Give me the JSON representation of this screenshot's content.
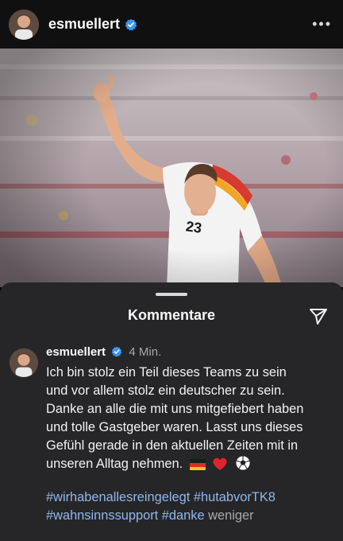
{
  "header": {
    "username": "esmuellert",
    "more_icon": "more-horizontal-icon"
  },
  "sheet": {
    "title": "Kommentare"
  },
  "comment": {
    "username": "esmuellert",
    "time": "4 Min.",
    "lines": [
      "Ich bin stolz ein Teil dieses Teams zu sein",
      "und vor allem stolz ein deutscher zu sein.",
      "Danke an alle die mit uns mitgefiebert haben",
      "und tolle Gastgeber waren. Lasst uns dieses",
      "Gefühl gerade in den aktuellen Zeiten mit in",
      "unseren Alltag nehmen."
    ],
    "emojis": [
      "flag-germany-emoji",
      "red-heart-emoji",
      "soccer-ball-emoji"
    ],
    "hashtags": [
      "#wirhabenallesreingelegt",
      "#hutabvorTK8",
      "#wahnsinnssupport",
      "#danke"
    ],
    "less_label": "weniger"
  },
  "colors": {
    "verified_blue": "#3897f0",
    "hashtag": "#8fb7ee",
    "sheet_bg": "#262628"
  }
}
